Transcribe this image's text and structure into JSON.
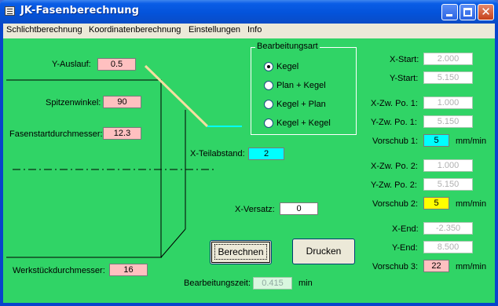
{
  "window": {
    "title": "JK-Fasenberechnung"
  },
  "menu": {
    "items": [
      {
        "label": "Schlichtberechnung"
      },
      {
        "label": "Koordinatenberechnung"
      },
      {
        "label": "Einstellungen"
      },
      {
        "label": "Info"
      }
    ]
  },
  "left": {
    "y_auslauf_label": "Y-Auslauf:",
    "y_auslauf_value": "0.5",
    "spitzenwinkel_label": "Spitzenwinkel:",
    "spitzenwinkel_value": "90",
    "fasenstart_label": "Fasenstartdurchmesser:",
    "fasenstart_value": "12.3",
    "werkstueck_label": "Werkstückdurchmesser:",
    "werkstueck_value": "16"
  },
  "middle": {
    "x_teilabstand_label": "X-Teilabstand:",
    "x_teilabstand_value": "2",
    "x_versatz_label": "X-Versatz:",
    "x_versatz_value": "0",
    "bearbeitungszeit_label": "Bearbeitungszeit:",
    "bearbeitungszeit_value": "0.415",
    "bearbeitungszeit_unit": "min"
  },
  "bearbeitungsart": {
    "title": "Bearbeitungsart",
    "options": [
      {
        "label": "Kegel",
        "selected": true
      },
      {
        "label": "Plan + Kegel",
        "selected": false
      },
      {
        "label": "Kegel + Plan",
        "selected": false
      },
      {
        "label": "Kegel + Kegel",
        "selected": false
      }
    ]
  },
  "buttons": {
    "berechnen": "Berechnen",
    "drucken": "Drucken"
  },
  "right": {
    "x_start_label": "X-Start:",
    "x_start_value": "2.000",
    "y_start_label": "Y-Start:",
    "y_start_value": "5.150",
    "x_zw1_label": "X-Zw. Po. 1:",
    "x_zw1_value": "1.000",
    "y_zw1_label": "Y-Zw. Po. 1:",
    "y_zw1_value": "5.150",
    "vorschub1_label": "Vorschub 1:",
    "vorschub1_value": "5",
    "vorschub1_unit": "mm/min",
    "x_zw2_label": "X-Zw. Po. 2:",
    "x_zw2_value": "1.000",
    "y_zw2_label": "Y-Zw. Po. 2:",
    "y_zw2_value": "5.150",
    "vorschub2_label": "Vorschub 2:",
    "vorschub2_value": "5",
    "vorschub2_unit": "mm/min",
    "x_end_label": "X-End:",
    "x_end_value": "-2.350",
    "y_end_label": "Y-End:",
    "y_end_value": "8.500",
    "vorschub3_label": "Vorschub 3:",
    "vorschub3_value": "22",
    "vorschub3_unit": "mm/min"
  },
  "colors": {
    "client_bg": "#30d466",
    "pink_field": "#ffc0c0",
    "cyan_field": "#00ffff",
    "yellow_field": "#ffff00",
    "tool_line": "#f4dfa0",
    "path_line": "#00ffff"
  }
}
